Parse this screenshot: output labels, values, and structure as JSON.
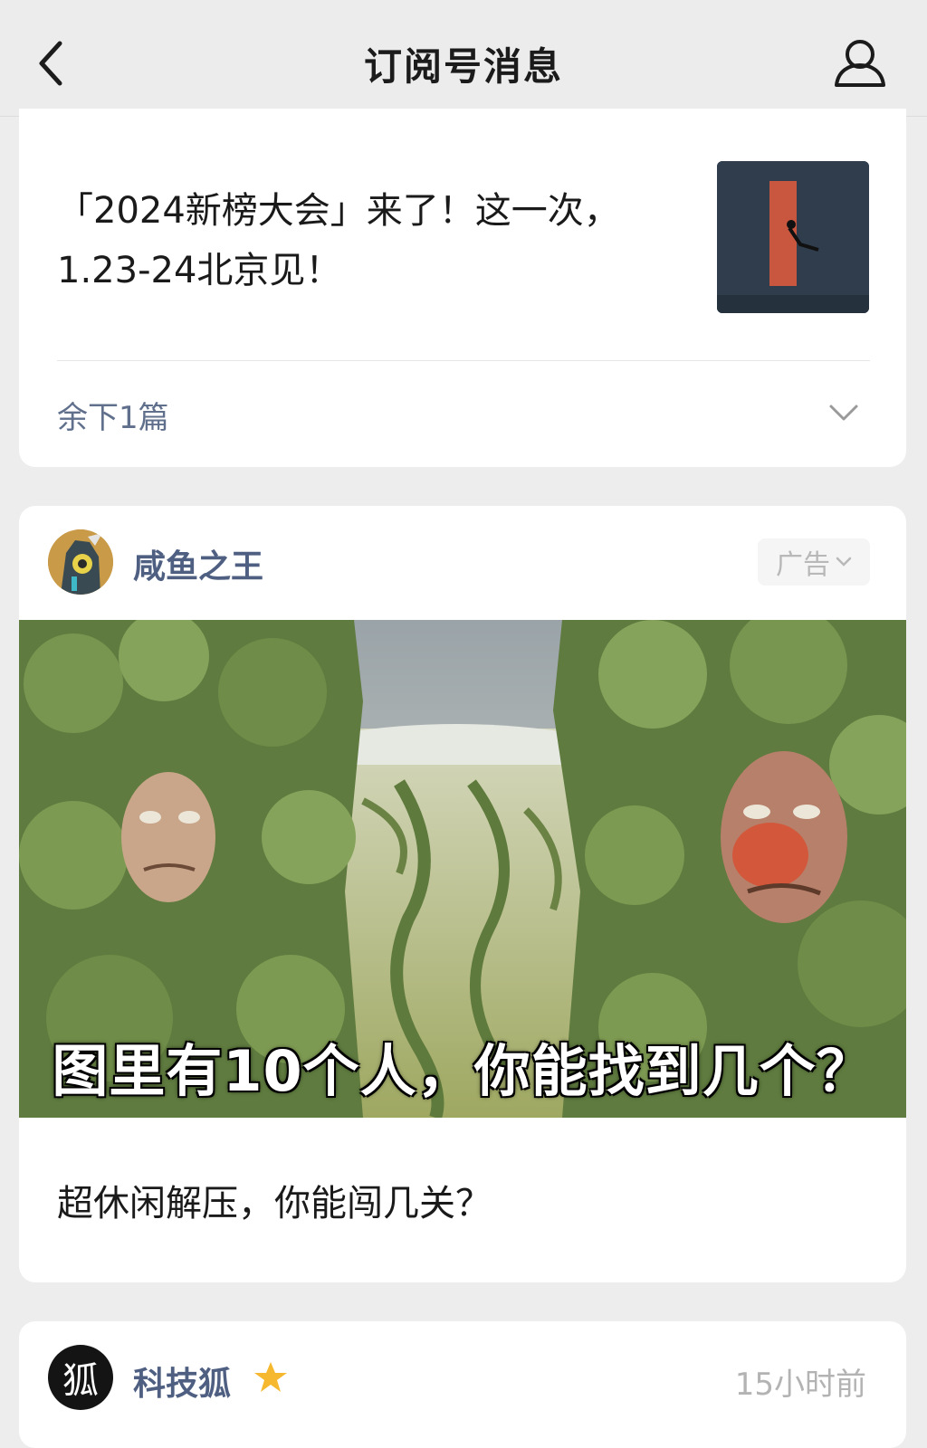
{
  "header": {
    "title": "订阅号消息",
    "back_icon": "chevron-left-icon",
    "profile_icon": "user-icon"
  },
  "feed": {
    "article_card": {
      "headline": "「2024新榜大会」来了！这一次，1.23-24北京见！",
      "more_label": "余下1篇",
      "expand_icon": "chevron-down-icon"
    },
    "ad_card": {
      "account_name": "咸鱼之王",
      "ad_label": "广告",
      "banner_caption": "图里有10个人，你能找到几个？",
      "description": "超休闲解压，你能闯几关？"
    },
    "next_card": {
      "avatar_text": "狐",
      "account_name": "科技狐",
      "star_icon": "star-icon",
      "time": "15小时前"
    }
  },
  "colors": {
    "background": "#ededed",
    "account_name": "#4e5f82",
    "muted_text": "#b3b3b3",
    "star": "#f5b82e"
  }
}
